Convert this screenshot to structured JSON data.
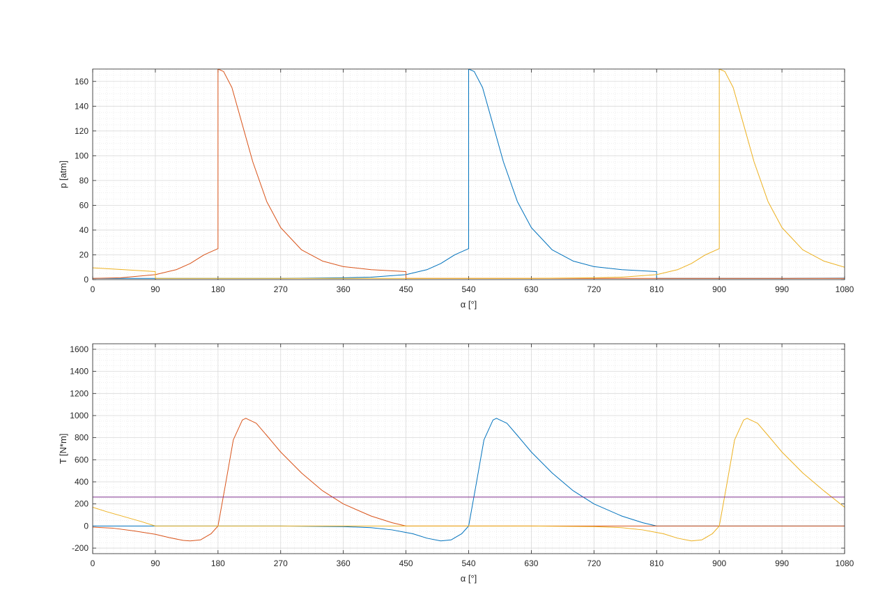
{
  "chart_data": [
    {
      "type": "line",
      "title": "",
      "xlabel": "α [°]",
      "ylabel": "p [atm]",
      "xlim": [
        0,
        1080
      ],
      "ylim": [
        0,
        170
      ],
      "xticks": [
        0,
        90,
        180,
        270,
        360,
        450,
        540,
        630,
        720,
        810,
        900,
        990,
        1080
      ],
      "yticks": [
        0,
        20,
        40,
        60,
        80,
        100,
        120,
        140,
        160
      ],
      "grid": true,
      "minor_grid": true,
      "legend": "none",
      "series": [
        {
          "color": "#0072BD",
          "points": [
            [
              0,
              1
            ],
            [
              90,
              1
            ],
            [
              180,
              1
            ],
            [
              270,
              1
            ],
            [
              360,
              1.5
            ],
            [
              400,
              2
            ],
            [
              450,
              4
            ],
            [
              480,
              8
            ],
            [
              500,
              13
            ],
            [
              520,
              20
            ],
            [
              540,
              25
            ],
            [
              540,
              170
            ],
            [
              548,
              168
            ],
            [
              560,
              155
            ],
            [
              575,
              125
            ],
            [
              590,
              95
            ],
            [
              610,
              63
            ],
            [
              630,
              42
            ],
            [
              660,
              24
            ],
            [
              690,
              15
            ],
            [
              720,
              10.5
            ],
            [
              760,
              8
            ],
            [
              810,
              6.5
            ],
            [
              810,
              1
            ],
            [
              900,
              1
            ],
            [
              1000,
              1
            ],
            [
              1080,
              1.2
            ]
          ]
        },
        {
          "color": "#D95319",
          "points": [
            [
              0,
              1
            ],
            [
              40,
              1.5
            ],
            [
              90,
              4
            ],
            [
              120,
              8
            ],
            [
              140,
              13
            ],
            [
              160,
              20
            ],
            [
              180,
              25
            ],
            [
              180,
              170
            ],
            [
              188,
              168
            ],
            [
              200,
              155
            ],
            [
              215,
              125
            ],
            [
              230,
              95
            ],
            [
              250,
              63
            ],
            [
              270,
              42
            ],
            [
              300,
              24
            ],
            [
              330,
              15
            ],
            [
              360,
              10.5
            ],
            [
              400,
              8
            ],
            [
              450,
              6.5
            ],
            [
              450,
              1
            ],
            [
              540,
              1
            ],
            [
              720,
              1
            ],
            [
              900,
              1
            ],
            [
              1080,
              1
            ]
          ]
        },
        {
          "color": "#EDB120",
          "points": [
            [
              0,
              9.5
            ],
            [
              45,
              8
            ],
            [
              90,
              6.5
            ],
            [
              90,
              1
            ],
            [
              180,
              1
            ],
            [
              360,
              1
            ],
            [
              540,
              1
            ],
            [
              630,
              1
            ],
            [
              720,
              1.5
            ],
            [
              760,
              2
            ],
            [
              810,
              4
            ],
            [
              840,
              8
            ],
            [
              860,
              13
            ],
            [
              880,
              20
            ],
            [
              900,
              25
            ],
            [
              900,
              170
            ],
            [
              908,
              168
            ],
            [
              920,
              155
            ],
            [
              935,
              125
            ],
            [
              950,
              95
            ],
            [
              970,
              63
            ],
            [
              990,
              42
            ],
            [
              1020,
              24
            ],
            [
              1050,
              15
            ],
            [
              1080,
              10
            ]
          ]
        }
      ]
    },
    {
      "type": "line",
      "title": "",
      "xlabel": "α [°]",
      "ylabel": "T [N*m]",
      "xlim": [
        0,
        1080
      ],
      "ylim": [
        -250,
        1650
      ],
      "xticks": [
        0,
        90,
        180,
        270,
        360,
        450,
        540,
        630,
        720,
        810,
        900,
        990,
        1080
      ],
      "yticks": [
        -200,
        0,
        200,
        400,
        600,
        800,
        1000,
        1200,
        1400,
        1600
      ],
      "grid": true,
      "minor_grid": true,
      "legend": "none",
      "series": [
        {
          "color": "#0072BD",
          "points": [
            [
              0,
              0
            ],
            [
              90,
              0
            ],
            [
              180,
              0
            ],
            [
              270,
              0
            ],
            [
              360,
              -5
            ],
            [
              400,
              -15
            ],
            [
              430,
              -35
            ],
            [
              460,
              -70
            ],
            [
              480,
              -110
            ],
            [
              500,
              -135
            ],
            [
              515,
              -125
            ],
            [
              530,
              -70
            ],
            [
              540,
              0
            ],
            [
              550,
              350
            ],
            [
              562,
              780
            ],
            [
              575,
              960
            ],
            [
              580,
              975
            ],
            [
              595,
              930
            ],
            [
              610,
              820
            ],
            [
              630,
              670
            ],
            [
              660,
              480
            ],
            [
              690,
              320
            ],
            [
              720,
              200
            ],
            [
              760,
              90
            ],
            [
              790,
              30
            ],
            [
              810,
              0
            ],
            [
              900,
              0
            ],
            [
              1000,
              0
            ],
            [
              1080,
              0
            ]
          ]
        },
        {
          "color": "#D95319",
          "points": [
            [
              0,
              -10
            ],
            [
              30,
              -20
            ],
            [
              60,
              -45
            ],
            [
              90,
              -75
            ],
            [
              110,
              -105
            ],
            [
              130,
              -130
            ],
            [
              140,
              -135
            ],
            [
              155,
              -125
            ],
            [
              170,
              -70
            ],
            [
              180,
              0
            ],
            [
              190,
              350
            ],
            [
              202,
              780
            ],
            [
              215,
              960
            ],
            [
              220,
              975
            ],
            [
              235,
              930
            ],
            [
              250,
              820
            ],
            [
              270,
              670
            ],
            [
              300,
              480
            ],
            [
              330,
              320
            ],
            [
              360,
              200
            ],
            [
              400,
              90
            ],
            [
              430,
              30
            ],
            [
              450,
              0
            ],
            [
              540,
              0
            ],
            [
              720,
              0
            ],
            [
              900,
              0
            ],
            [
              1080,
              0
            ]
          ]
        },
        {
          "color": "#EDB120",
          "points": [
            [
              0,
              170
            ],
            [
              20,
              130
            ],
            [
              45,
              85
            ],
            [
              70,
              40
            ],
            [
              90,
              0
            ],
            [
              180,
              0
            ],
            [
              360,
              0
            ],
            [
              540,
              0
            ],
            [
              630,
              0
            ],
            [
              720,
              -5
            ],
            [
              760,
              -15
            ],
            [
              790,
              -35
            ],
            [
              820,
              -70
            ],
            [
              840,
              -110
            ],
            [
              860,
              -135
            ],
            [
              875,
              -125
            ],
            [
              890,
              -70
            ],
            [
              900,
              0
            ],
            [
              910,
              350
            ],
            [
              922,
              780
            ],
            [
              935,
              960
            ],
            [
              940,
              975
            ],
            [
              955,
              930
            ],
            [
              970,
              820
            ],
            [
              990,
              670
            ],
            [
              1020,
              480
            ],
            [
              1050,
              320
            ],
            [
              1080,
              170
            ]
          ]
        },
        {
          "color": "#7E2F8E",
          "points": [
            [
              0,
              262
            ],
            [
              1080,
              262
            ]
          ]
        }
      ]
    }
  ]
}
